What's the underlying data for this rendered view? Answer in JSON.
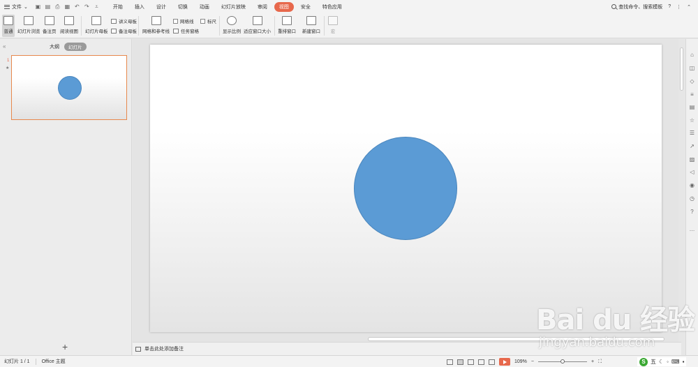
{
  "menubar": {
    "file_label": "文件",
    "tabs": [
      {
        "label": "开始"
      },
      {
        "label": "插入"
      },
      {
        "label": "设计"
      },
      {
        "label": "切换"
      },
      {
        "label": "动画"
      },
      {
        "label": "幻灯片放映"
      },
      {
        "label": "审阅"
      },
      {
        "label": "视图",
        "active": true
      },
      {
        "label": "安全"
      },
      {
        "label": "特色应用"
      }
    ],
    "search_label": "查找命令、搜索模板",
    "help_label": "?",
    "more_label": "⋮"
  },
  "ribbon": {
    "normal": "普通",
    "slide_browser": "幻灯片浏览",
    "notes_page": "备注页",
    "reading_view": "阅读视图",
    "slide_master": "幻灯片母板",
    "handout_master": "讲义母板",
    "notes_master": "备注母板",
    "grid_guides": "网格和参考线",
    "gridlines": "网格线",
    "ruler": "标尺",
    "task_pane": "任务窗格",
    "zoom": "显示比例",
    "fit_window": "适应窗口大小",
    "arrange_window": "重排窗口",
    "new_window": "新建窗口",
    "macro": "宏"
  },
  "leftpanel": {
    "outline_tab": "大纲",
    "slides_tab": "幻灯片",
    "slide_number": "1",
    "add_label": "+"
  },
  "notes": {
    "placeholder": "单击此处添加备注"
  },
  "status": {
    "slide_count": "幻灯片 1 / 1",
    "theme": "Office 主题",
    "zoom_value": "109%",
    "zoom_minus": "−",
    "zoom_plus": "+",
    "ime_label": "五"
  },
  "watermark": {
    "brand": "Bai du 经验",
    "url": "jingyan.baidu.com"
  },
  "colors": {
    "accent": "#e7684c",
    "shape_fill": "#5b9bd5"
  }
}
